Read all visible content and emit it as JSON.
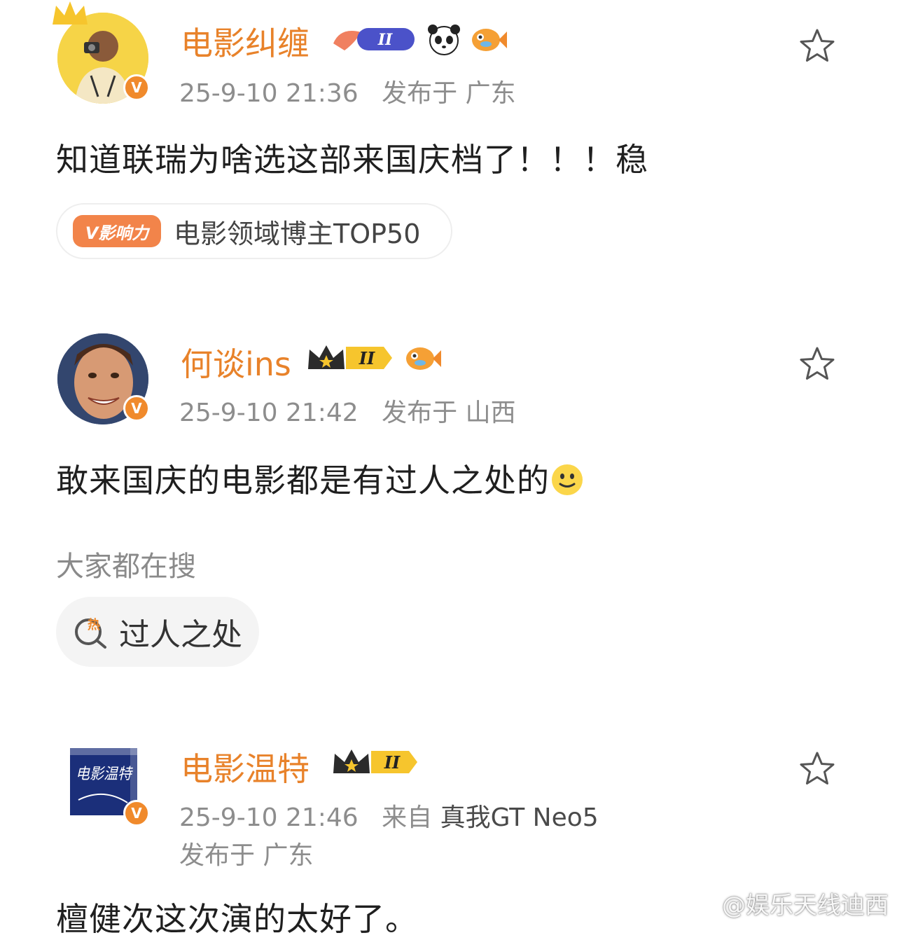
{
  "comments": [
    {
      "name": "电影纠缠",
      "level": "II",
      "timestamp": "25-9-10 21:36",
      "location": "发布于 广东",
      "content": "知道联瑞为啥选这部来国庆档了！！！稳",
      "rank_badge": "V影响力",
      "rank_text": "电影领域博主TOP50"
    },
    {
      "name": "何谈ins",
      "level": "II",
      "timestamp": "25-9-10 21:42",
      "location": "发布于 山西",
      "content": "敢来国庆的电影都是有过人之处的"
    },
    {
      "name": "电影温特",
      "level": "II",
      "timestamp": "25-9-10 21:46",
      "source_prefix": "来自",
      "source": "真我GT Neo5",
      "location": "发布于 广东",
      "content": "檀健次这次演的太好了。",
      "avatar_text": "电影温特"
    }
  ],
  "trending": {
    "label": "大家都在搜",
    "hot_badge": "热",
    "item": "过人之处"
  },
  "watermark": "@娱乐天线迪西",
  "verified_badge": "V",
  "colors": {
    "name": "#e8822a",
    "meta": "#8d8d8d",
    "badge": "#f08a2c"
  },
  "icons": [
    "star-icon",
    "crown-icon",
    "panda-icon",
    "fish-icon",
    "shrimp-icon",
    "smile-emoji-icon",
    "hot-search-icon",
    "weibo-logo-icon"
  ]
}
